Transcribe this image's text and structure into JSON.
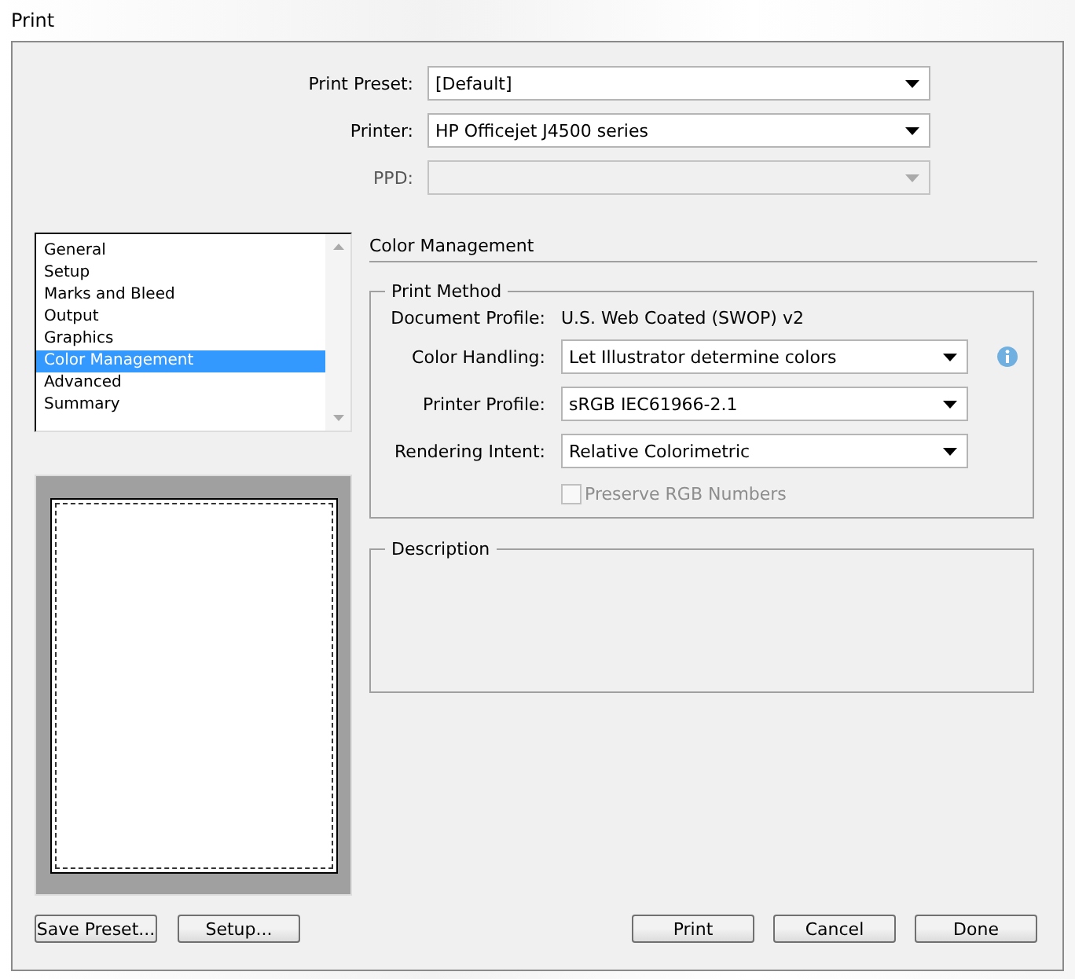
{
  "window": {
    "title": "Print"
  },
  "top_fields": [
    {
      "label": "Print Preset:",
      "value": "[Default]",
      "disabled": false
    },
    {
      "label": "Printer:",
      "value": "HP Officejet J4500 series",
      "disabled": false
    },
    {
      "label": "PPD:",
      "disabled": true
    }
  ],
  "sections": [
    {
      "label": "General",
      "selected": false
    },
    {
      "label": "Setup",
      "selected": false
    },
    {
      "label": "Marks and Bleed",
      "selected": false
    },
    {
      "label": "Output",
      "selected": false
    },
    {
      "label": "Graphics",
      "selected": false
    },
    {
      "label": "Color Management",
      "selected": true
    },
    {
      "label": "Advanced",
      "selected": false
    },
    {
      "label": "Summary",
      "selected": false
    }
  ],
  "panel": {
    "title": "Color Management",
    "print_method": {
      "title": "Print Method",
      "document_profile": {
        "label": "Document Profile:",
        "value": "U.S. Web Coated (SWOP) v2"
      },
      "fields": [
        {
          "label": "Color Handling:",
          "value": "Let Illustrator determine colors",
          "info": true
        },
        {
          "label": "Printer Profile:",
          "value": "sRGB IEC61966-2.1",
          "info": false
        },
        {
          "label": "Rendering Intent:",
          "value": "Relative Colorimetric",
          "info": false
        }
      ],
      "preserve_rgb": {
        "label": "Preserve RGB Numbers",
        "checked": false,
        "disabled": true
      }
    },
    "description": {
      "title": "Description"
    }
  },
  "buttons_left": [
    "Save Preset...",
    "Setup..."
  ],
  "buttons_right": [
    "Print",
    "Cancel",
    "Done"
  ]
}
